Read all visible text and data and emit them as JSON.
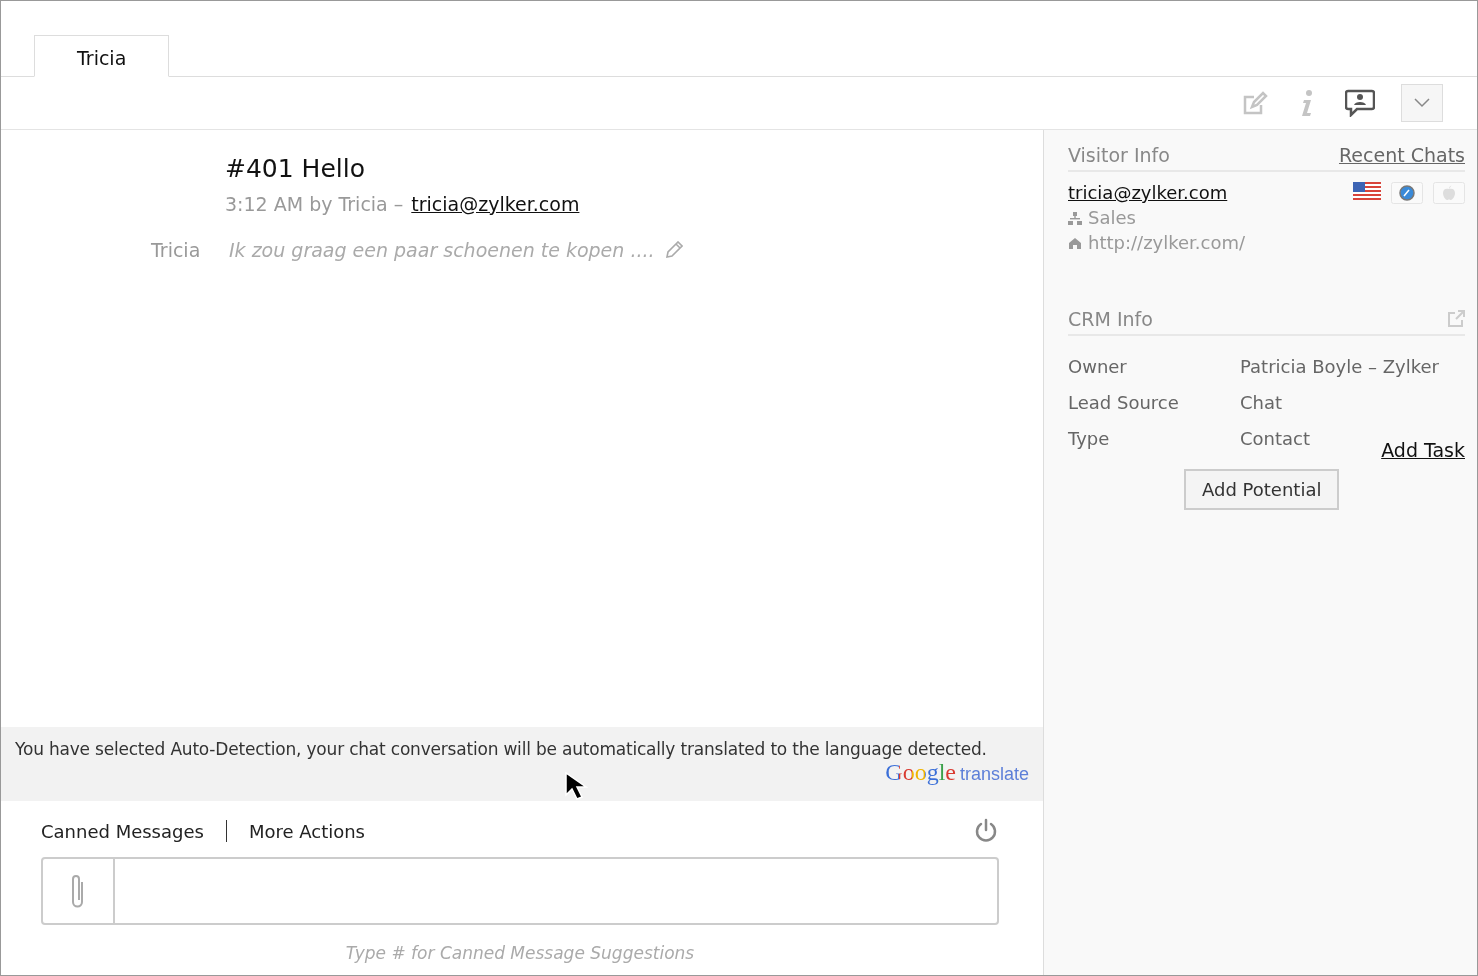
{
  "tabs": [
    {
      "label": "Tricia",
      "selected": true
    }
  ],
  "chat": {
    "title": "#401 Hello",
    "meta": "3:12 AM by Tricia –",
    "email": "tricia@zylker.com",
    "messages": [
      {
        "sender": "Tricia",
        "text": "Ik zou graag een paar schoenen te kopen ...."
      }
    ]
  },
  "translation_banner": {
    "text": "You have selected Auto-Detection, your chat conversation will be automatically translated to the language detected.",
    "logo": "Google",
    "logo_suffix": "translate"
  },
  "composer": {
    "actions": [
      "Canned Messages",
      "More Actions"
    ],
    "hint": "Type # for Canned Message Suggestions"
  },
  "visitor_info": {
    "title": "Visitor Info",
    "link": "Recent Chats",
    "email": "tricia@zylker.com",
    "department": "Sales",
    "url": "http://zylker.com/"
  },
  "crm_info": {
    "title": "CRM Info",
    "fields": [
      {
        "label": "Owner",
        "value": "Patricia Boyle – Zylker"
      },
      {
        "label": "Lead Source",
        "value": "Chat"
      },
      {
        "label": "Type",
        "value": "Contact"
      }
    ],
    "add_task": "Add Task",
    "button": "Add Potential"
  }
}
